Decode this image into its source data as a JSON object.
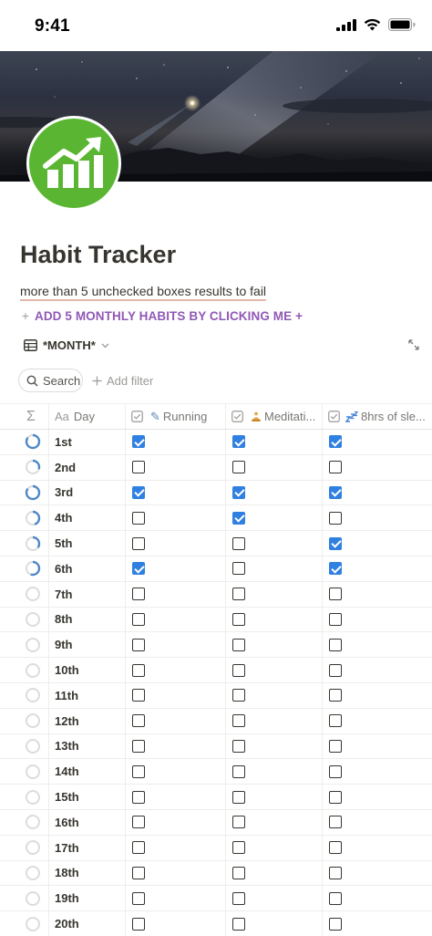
{
  "status_bar": {
    "time": "9:41"
  },
  "page": {
    "title": "Habit Tracker",
    "subtitle": "more than 5 unchecked boxes results to fail",
    "add_habits": "ADD 5 MONTHLY HABITS BY CLICKING ME +",
    "add_habits_plus": "+",
    "icon": "trend-up-chart-icon"
  },
  "view": {
    "name": "*MONTH*",
    "icon": "table-icon"
  },
  "toolbar": {
    "search_label": "Search",
    "add_filter_label": "Add filter"
  },
  "columns": {
    "progress": {
      "icon": "sigma-icon",
      "glyph": "Σ"
    },
    "day": {
      "icon_text": "Aa",
      "label": "Day"
    },
    "habit1": {
      "label": "Running",
      "emoji": "✎"
    },
    "habit2": {
      "label": "Meditati...",
      "emoji": "🧘"
    },
    "habit3": {
      "label": "8hrs of sle...",
      "emoji": "💤"
    }
  },
  "colors": {
    "accent_purple": "#9058b5",
    "check_blue": "#2f80e0",
    "icon_green": "#5ab632"
  },
  "rows": [
    {
      "day": "1st",
      "progress": 0.85,
      "h1": true,
      "h2": true,
      "h3": true
    },
    {
      "day": "2nd",
      "progress": 0.3,
      "h1": false,
      "h2": false,
      "h3": false
    },
    {
      "day": "3rd",
      "progress": 0.85,
      "h1": true,
      "h2": true,
      "h3": true
    },
    {
      "day": "4th",
      "progress": 0.45,
      "h1": false,
      "h2": true,
      "h3": false
    },
    {
      "day": "5th",
      "progress": 0.35,
      "h1": false,
      "h2": false,
      "h3": true
    },
    {
      "day": "6th",
      "progress": 0.55,
      "h1": true,
      "h2": false,
      "h3": true
    },
    {
      "day": "7th",
      "progress": 0,
      "h1": false,
      "h2": false,
      "h3": false
    },
    {
      "day": "8th",
      "progress": 0,
      "h1": false,
      "h2": false,
      "h3": false
    },
    {
      "day": "9th",
      "progress": 0,
      "h1": false,
      "h2": false,
      "h3": false
    },
    {
      "day": "10th",
      "progress": 0,
      "h1": false,
      "h2": false,
      "h3": false
    },
    {
      "day": "11th",
      "progress": 0,
      "h1": false,
      "h2": false,
      "h3": false
    },
    {
      "day": "12th",
      "progress": 0,
      "h1": false,
      "h2": false,
      "h3": false
    },
    {
      "day": "13th",
      "progress": 0,
      "h1": false,
      "h2": false,
      "h3": false
    },
    {
      "day": "14th",
      "progress": 0,
      "h1": false,
      "h2": false,
      "h3": false
    },
    {
      "day": "15th",
      "progress": 0,
      "h1": false,
      "h2": false,
      "h3": false
    },
    {
      "day": "16th",
      "progress": 0,
      "h1": false,
      "h2": false,
      "h3": false
    },
    {
      "day": "17th",
      "progress": 0,
      "h1": false,
      "h2": false,
      "h3": false
    },
    {
      "day": "18th",
      "progress": 0,
      "h1": false,
      "h2": false,
      "h3": false
    },
    {
      "day": "19th",
      "progress": 0,
      "h1": false,
      "h2": false,
      "h3": false
    },
    {
      "day": "20th",
      "progress": 0,
      "h1": false,
      "h2": false,
      "h3": false
    }
  ]
}
